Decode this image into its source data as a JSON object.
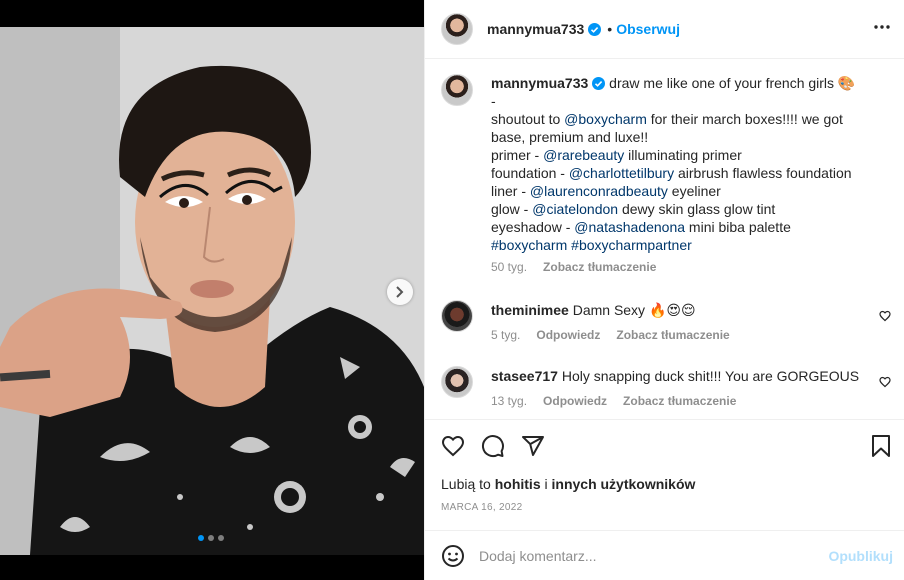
{
  "post": {
    "author": "mannymua733",
    "follow_label": "Obserwuj",
    "more_label": "…",
    "carousel": {
      "slides": 3,
      "active": 1
    }
  },
  "caption": {
    "username": "mannymua733",
    "lines": [
      [
        {
          "t": "draw me like one of your french girls 🎨"
        }
      ],
      [
        {
          "t": "-"
        }
      ],
      [
        {
          "t": "shoutout to "
        },
        {
          "t": "@boxycharm",
          "m": true
        },
        {
          "t": " for their march boxes!!!! we got"
        }
      ],
      [
        {
          "t": "base, premium and luxe!!"
        }
      ],
      [
        {
          "t": "primer - "
        },
        {
          "t": "@rarebeauty",
          "m": true
        },
        {
          "t": " illuminating primer"
        }
      ],
      [
        {
          "t": "foundation - "
        },
        {
          "t": "@charlottetilbury",
          "m": true
        },
        {
          "t": " airbrush flawless foundation"
        }
      ],
      [
        {
          "t": "liner - "
        },
        {
          "t": "@laurenconradbeauty",
          "m": true
        },
        {
          "t": " eyeliner"
        }
      ],
      [
        {
          "t": "glow - "
        },
        {
          "t": "@ciatelondon",
          "m": true
        },
        {
          "t": " dewy skin glass glow tint"
        }
      ],
      [
        {
          "t": "eyeshadow - "
        },
        {
          "t": "@natashadenona",
          "m": true
        },
        {
          "t": " mini biba palette"
        }
      ],
      [
        {
          "t": "#boxycharm",
          "m": true
        },
        {
          "t": " "
        },
        {
          "t": "#boxycharmpartner",
          "m": true
        }
      ]
    ],
    "time": "50 tyg.",
    "translate": "Zobacz tłumaczenie"
  },
  "comments": [
    {
      "username": "theminimee",
      "text": "Damn Sexy 🔥😍😌",
      "time": "5 tyg.",
      "reply": "Odpowiedz",
      "translate": "Zobacz tłumaczenie"
    },
    {
      "username": "stasee717",
      "text": "Holy snapping duck shit!!! You are GORGEOUS",
      "time": "13 tyg.",
      "reply": "Odpowiedz",
      "translate": "Zobacz tłumaczenie"
    }
  ],
  "likes": {
    "prefix": "Lubią to ",
    "user": "hohitis",
    "mid": " i ",
    "others": "innych użytkowników"
  },
  "date": "MARCA 16, 2022",
  "add_comment": {
    "placeholder": "Dodaj komentarz...",
    "publish": "Opublikuj"
  },
  "colors": {
    "accent": "#0095f6",
    "mention": "#00376b",
    "secondary": "#8e8e8e",
    "publish_disabled": "#b2dffc"
  }
}
